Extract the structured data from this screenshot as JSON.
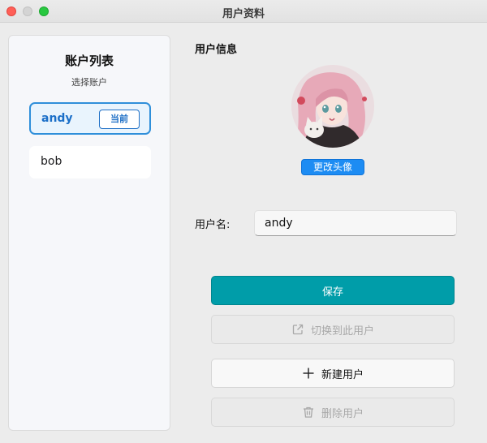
{
  "window": {
    "title": "用户资料"
  },
  "sidebar": {
    "title": "账户列表",
    "subtitle": "选择账户",
    "accounts": [
      {
        "name": "andy",
        "badge": "当前",
        "selected": true
      },
      {
        "name": "bob",
        "selected": false
      }
    ]
  },
  "main": {
    "section_title": "用户信息",
    "change_avatar_label": "更改头像",
    "username_label": "用户名:",
    "username_value": "andy"
  },
  "actions": {
    "save_label": "保存",
    "switch_label": "切换到此用户",
    "new_label": "新建用户",
    "delete_label": "删除用户"
  },
  "colors": {
    "accent": "#009da9",
    "selection": "#2f8fda",
    "avatar_button": "#1d8cf3"
  },
  "icons": {
    "switch": "external-link-icon",
    "new": "plus-icon",
    "delete": "trash-icon"
  }
}
